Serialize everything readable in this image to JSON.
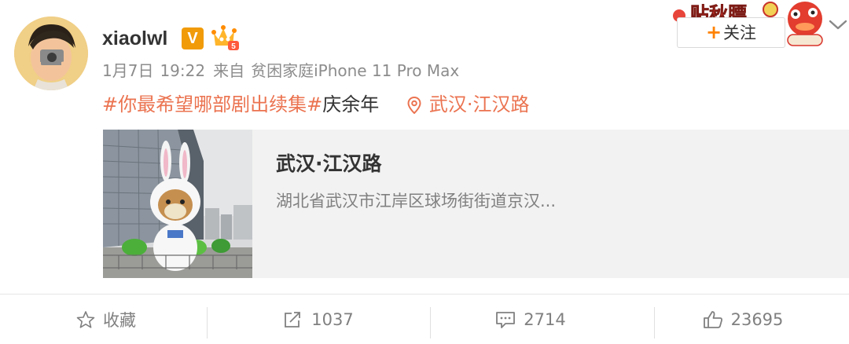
{
  "user": {
    "name": "xiaolwl",
    "vip_badge": "V",
    "fan_level": "5"
  },
  "meta": {
    "date": "1月7日",
    "time": "19:22",
    "from_label": "来自",
    "device": "贫困家庭iPhone 11 Pro Max"
  },
  "content": {
    "topic": "#你最希望哪部剧出续集#",
    "text": "庆余年",
    "location_tag": "武汉·江汉路"
  },
  "location_card": {
    "title": "武汉·江汉路",
    "address": "湖北省武汉市江岸区球场街街道京汉..."
  },
  "header": {
    "follow_label": "关注",
    "follow_plus": "+",
    "banner_text": "贴秋膘"
  },
  "actions": {
    "favorite_label": "收藏",
    "repost_count": "1037",
    "comment_count": "2714",
    "like_count": "23695"
  },
  "colors": {
    "accent": "#eb7350",
    "follow_orange": "#ff8200",
    "vip": "#f19b09"
  }
}
